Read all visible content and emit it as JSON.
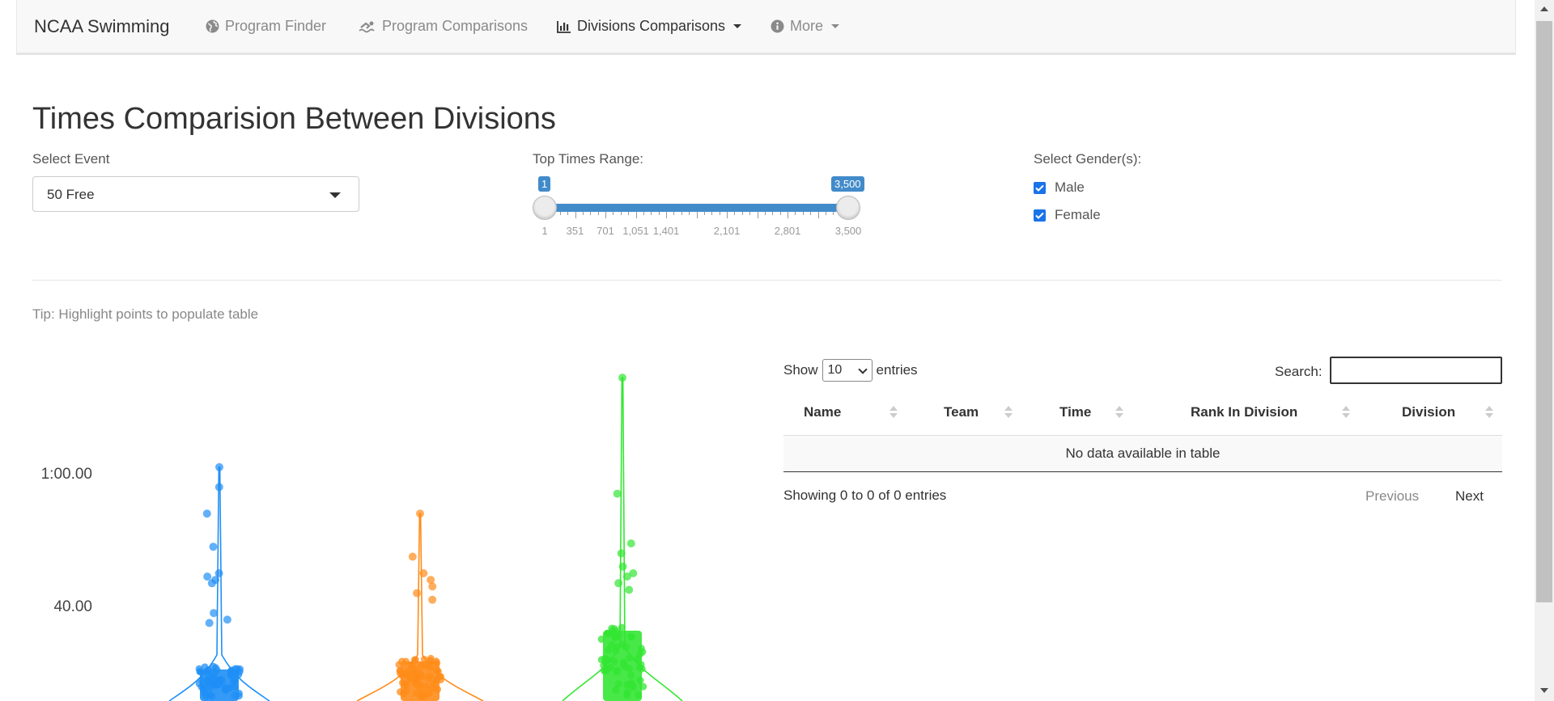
{
  "navbar": {
    "brand": "NCAA Swimming",
    "items": [
      {
        "label": "Program Finder",
        "icon": "globe-icon"
      },
      {
        "label": "Program Comparisons",
        "icon": "swimmer-icon"
      },
      {
        "label": "Divisions Comparisons",
        "icon": "bar-chart-icon",
        "active": true
      },
      {
        "label": "More",
        "icon": "info-circle-icon"
      }
    ]
  },
  "page": {
    "title": "Times Comparision Between Divisions"
  },
  "controls": {
    "event_label": "Select Event",
    "event_value": "50 Free",
    "range_label": "Top Times Range:",
    "range_min_badge": "1",
    "range_max_badge": "3,500",
    "range_ticks": [
      "1",
      "351",
      "701",
      "1,051",
      "1,401",
      "2,101",
      "2,801",
      "3,500"
    ],
    "range_values": [
      1,
      3500
    ],
    "range_bounds": [
      1,
      3500
    ],
    "gender_label": "Select Gender(s):",
    "genders": [
      {
        "label": "Male",
        "checked": true
      },
      {
        "label": "Female",
        "checked": true
      }
    ]
  },
  "tip": "Tip: Highlight points to populate table",
  "chart_data": {
    "type": "scatter",
    "subtype": "violin-with-jittered-points",
    "ytick_labels": [
      "1:00.00",
      "40.00"
    ],
    "ytick_values": [
      60,
      40
    ],
    "series": [
      {
        "color": "#1f8ff5",
        "max": 61,
        "outliers": [
          61,
          58,
          54,
          49,
          45,
          44.5,
          44,
          43.5,
          39,
          38,
          37.5
        ]
      },
      {
        "color": "#ff8c1a",
        "max": 54,
        "outliers": [
          54,
          47.5,
          45,
          44,
          43,
          42,
          41
        ]
      },
      {
        "color": "#33e633",
        "max": 74.5,
        "outliers": [
          74.5,
          57,
          49.5,
          48,
          46,
          45,
          44.5,
          43.5,
          42.5
        ]
      }
    ],
    "colors": [
      "#1f8ff5",
      "#ff8c1a",
      "#33e633"
    ]
  },
  "table": {
    "show_label": "Show",
    "length_value": "10",
    "entries_label": "entries",
    "search_label": "Search:",
    "columns": [
      "Name",
      "Team",
      "Time",
      "Rank In Division",
      "Division"
    ],
    "empty_message": "No data available in table",
    "info": "Showing 0 to 0 of 0 entries",
    "previous": "Previous",
    "next": "Next"
  }
}
